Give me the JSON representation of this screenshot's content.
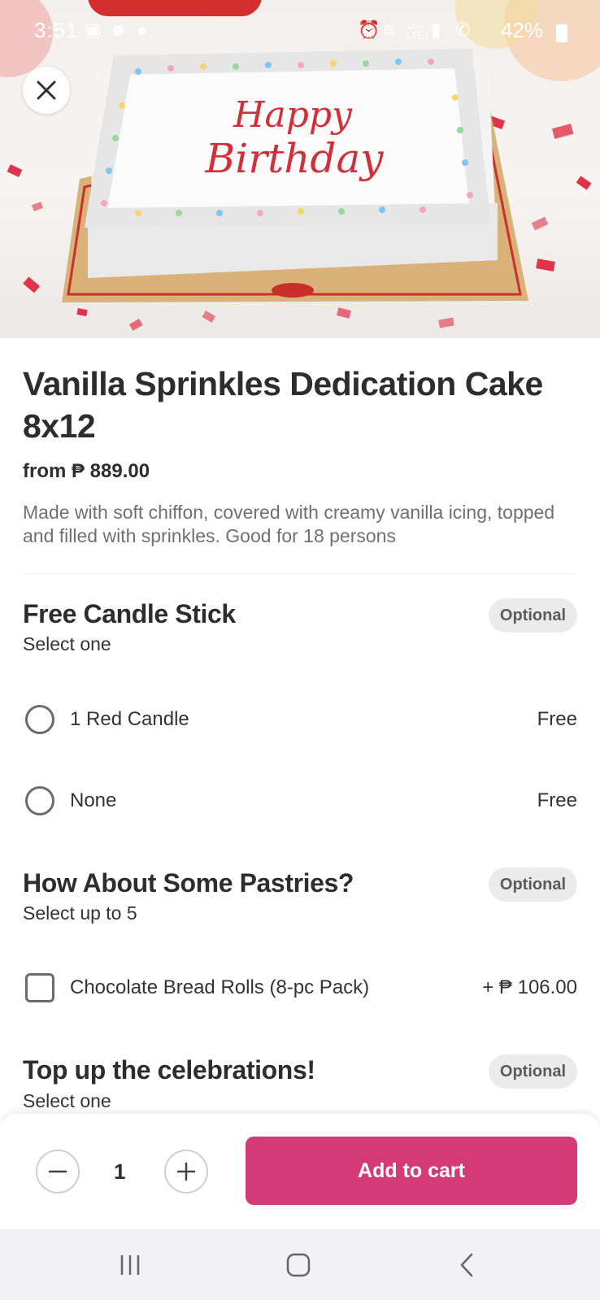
{
  "status_bar": {
    "time": "3:51",
    "battery": "42%",
    "icons": [
      "gallery-icon",
      "foodpanda-icon",
      "chat-icon",
      "alarm-icon",
      "wifi-icon",
      "signal-icon",
      "call-signal-icon"
    ],
    "network_label": "Vo))\nLTE1"
  },
  "hero": {
    "cake_text_line1": "Happy",
    "cake_text_line2": "Birthday",
    "close_icon": "close-icon"
  },
  "product": {
    "title": "Vanilla Sprinkles Dedication Cake 8x12",
    "price_from": "from ₱ 889.00",
    "description": "Made with soft chiffon, covered with creamy vanilla icing, topped and filled with sprinkles. Good for 18 persons"
  },
  "sections": [
    {
      "title": "Free Candle Stick",
      "subtitle": "Select one",
      "badge": "Optional",
      "options": [
        {
          "label": "1 Red Candle",
          "price": "Free"
        },
        {
          "label": "None",
          "price": "Free"
        }
      ]
    },
    {
      "title": "How About Some Pastries?",
      "subtitle": "Select up to 5",
      "badge": "Optional",
      "options": [
        {
          "label": "Chocolate Bread Rolls (8-pc Pack)",
          "price": "+ ₱ 106.00"
        }
      ]
    },
    {
      "title": "Top up the celebrations!",
      "subtitle": "Select one",
      "badge": "Optional",
      "options": []
    }
  ],
  "cart": {
    "quantity": "1",
    "add_label": "Add to cart",
    "accent_color": "#d43a77"
  },
  "nav": {
    "icons": [
      "recent-apps-icon",
      "home-icon",
      "back-icon"
    ]
  }
}
